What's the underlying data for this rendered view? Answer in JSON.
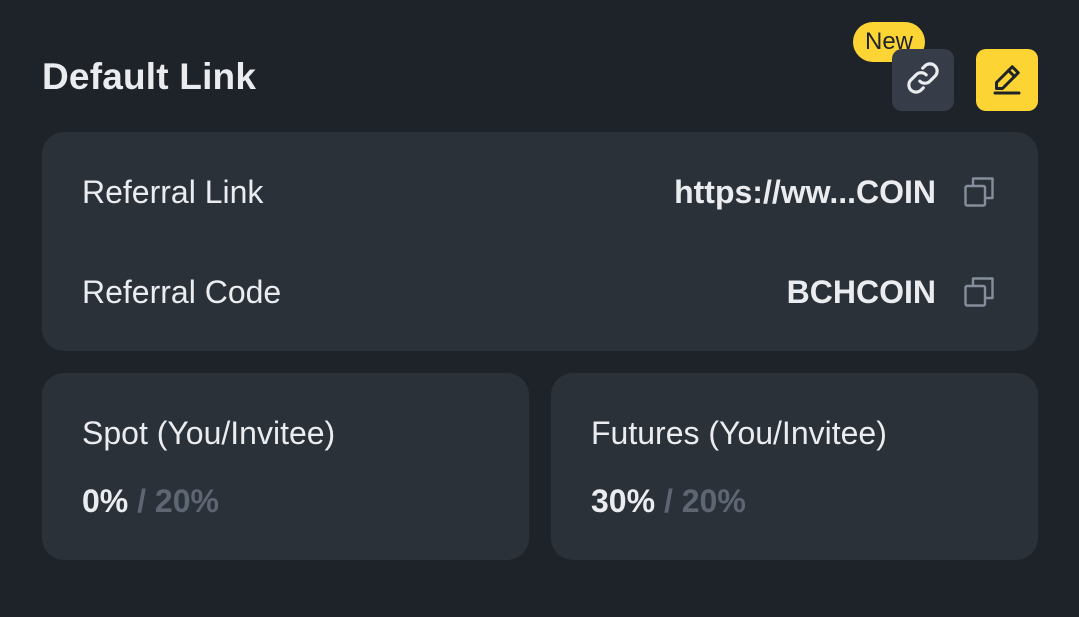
{
  "header": {
    "title": "Default Link",
    "new_badge": "New",
    "link_icon": "link-icon",
    "edit_icon": "pencil-icon"
  },
  "referral": {
    "link_label": "Referral Link",
    "link_value": "https://ww...COIN",
    "code_label": "Referral Code",
    "code_value": "BCHCOIN",
    "copy_icon": "copy-icon"
  },
  "rates": {
    "spot": {
      "label": "Spot (You/Invitee)",
      "you": "0%",
      "separator": "/",
      "invitee": "20%"
    },
    "futures": {
      "label": "Futures (You/Invitee)",
      "you": "30%",
      "separator": "/",
      "invitee": "20%"
    }
  },
  "colors": {
    "background": "#1e2329",
    "card": "#2b3139",
    "accent": "#fcd535",
    "text_primary": "#eaecef",
    "text_muted": "#5e6673"
  }
}
